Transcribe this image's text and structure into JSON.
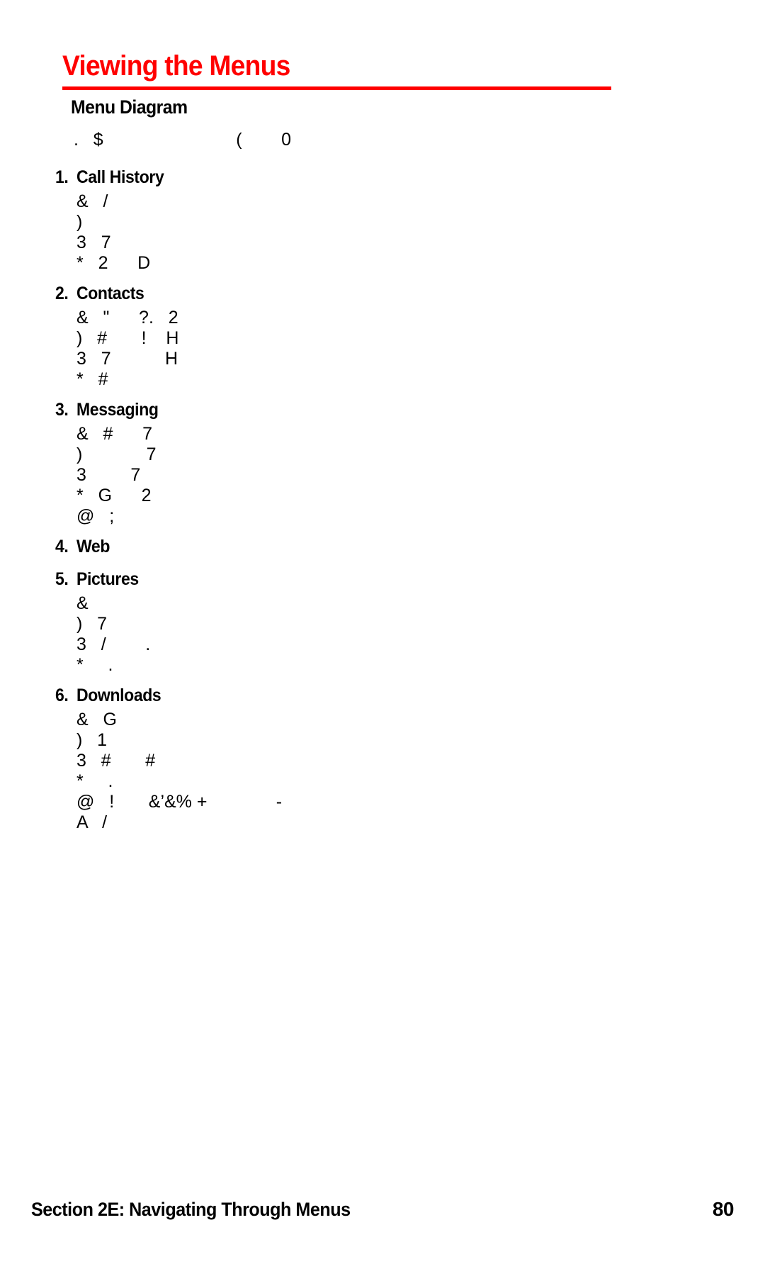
{
  "document": {
    "title": "Viewing the Menus",
    "title_color": "#ff0000",
    "rule_color": "#ff0000",
    "section_heading": "Menu Diagram",
    "intro_line": ".   $                           (        0"
  },
  "menu": {
    "groups": [
      {
        "number": "1.",
        "title": "Call History",
        "items": [
          "&   /",
          ")",
          "3   7",
          "*   2      D"
        ]
      },
      {
        "number": "2.",
        "title": "Contacts",
        "items": [
          "&   \"      ?.   2",
          ")   #       !    H",
          "3   7           H",
          "*   #"
        ]
      },
      {
        "number": "3.",
        "title": "Messaging",
        "items": [
          "&   #      7",
          ")             7",
          "3         7",
          "*   G      2",
          "@   ;"
        ]
      },
      {
        "number": "4.",
        "title": "Web",
        "items": []
      },
      {
        "number": "5.",
        "title": "Pictures",
        "items": [
          "&",
          ")   7",
          "3   /        .",
          "*     ."
        ]
      },
      {
        "number": "6.",
        "title": "Downloads",
        "items": [
          "&   G",
          ")   1",
          "3   #       #",
          "*     .",
          "@   !       &’&% +              -",
          "A   /"
        ]
      }
    ]
  },
  "footer": {
    "left": "Section 2E: Navigating Through Menus",
    "right": "80"
  }
}
